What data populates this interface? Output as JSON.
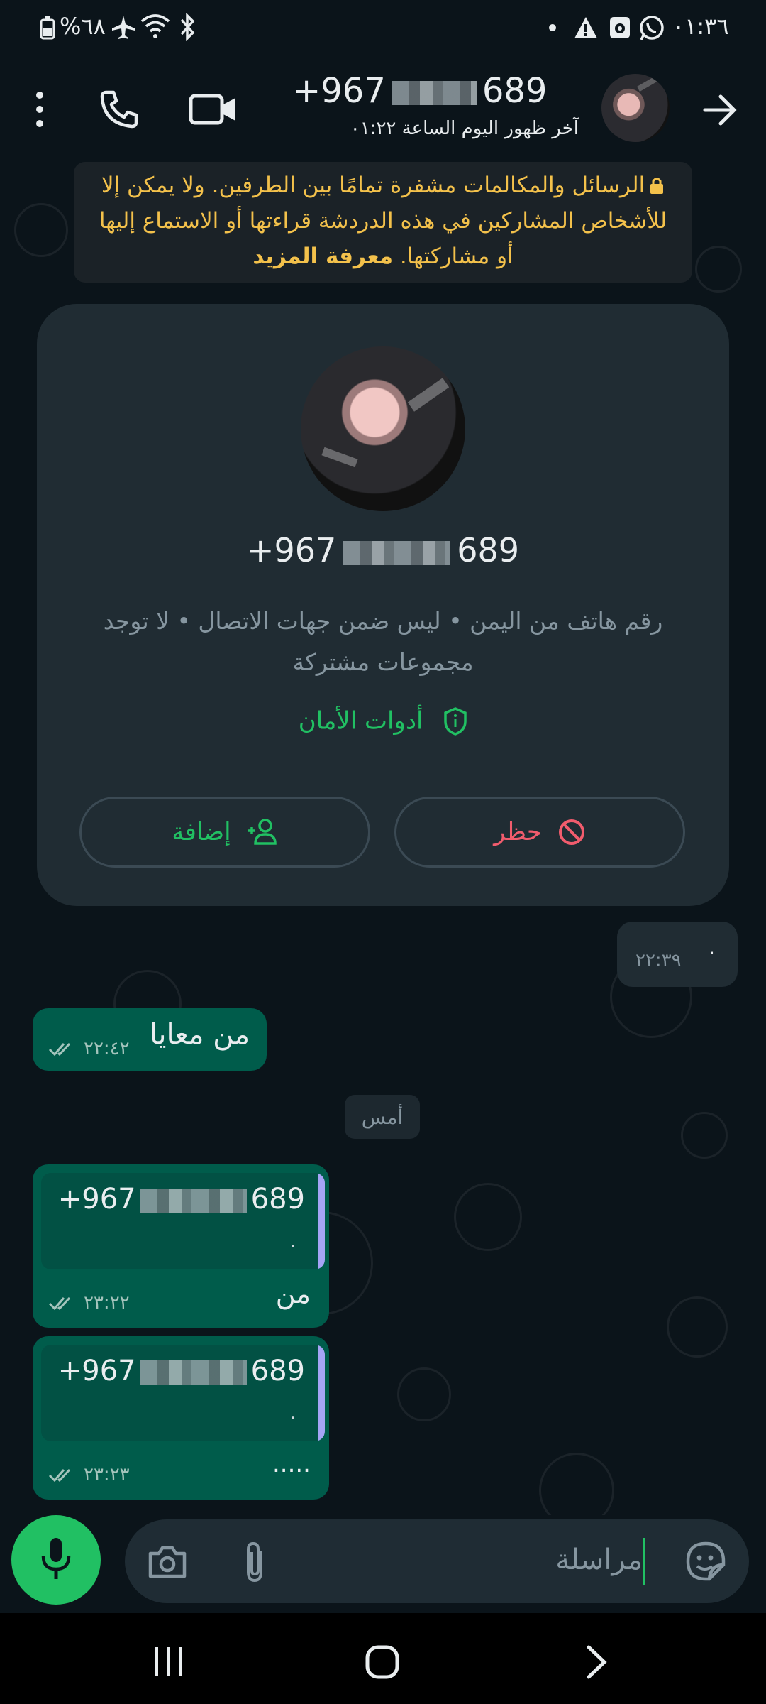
{
  "status_bar": {
    "time": "٠١:٣٦",
    "battery_text": "%٦٨",
    "icons": [
      "battery-icon",
      "airplane-icon",
      "wifi-icon",
      "bluetooth-icon",
      "dot-icon",
      "warning-icon",
      "app-icon",
      "whatsapp-icon"
    ]
  },
  "header": {
    "contact_phone_prefix": "+967",
    "contact_phone_suffix": "689",
    "last_seen": "آخر ظهور اليوم الساعة ٠١:٢٢",
    "icons": [
      "more-icon",
      "call-icon",
      "video-call-icon",
      "back-arrow-icon"
    ]
  },
  "encryption_notice": {
    "text": "الرسائل والمكالمات مشفرة تمامًا بين الطرفين. ولا يمكن إلا للأشخاص المشاركين في هذه الدردشة قراءتها أو الاستماع إليها أو مشاركتها.",
    "link": "معرفة المزيد"
  },
  "contact_card": {
    "phone_prefix": "+967",
    "phone_suffix": "689",
    "description": "رقم هاتف من اليمن • ليس ضمن جهات الاتصال • لا توجد مجموعات مشتركة",
    "security_tools": "أدوات الأمان",
    "block_label": "حظر",
    "add_label": "إضافة"
  },
  "messages": [
    {
      "dir": "in",
      "text": "٠",
      "time": "٢٢:٣٩"
    },
    {
      "dir": "out",
      "text": "من معايا",
      "time": "٢٢:٤٢"
    },
    {
      "type": "date",
      "text": "أمس"
    },
    {
      "dir": "out",
      "quote_prefix": "+967",
      "quote_suffix": "689",
      "quote_text": ".",
      "text": "من",
      "time": "٢٣:٢٢"
    },
    {
      "dir": "out",
      "quote_prefix": "+967",
      "quote_suffix": "689",
      "quote_text": ".",
      "text": ".....",
      "time": "٢٣:٢٣"
    }
  ],
  "input": {
    "placeholder": "مراسلة",
    "icons": [
      "mic-icon",
      "camera-icon",
      "attach-icon",
      "sticker-icon"
    ]
  },
  "nav_bar": {
    "icons": [
      "recents-icon",
      "home-icon",
      "back-icon"
    ]
  },
  "colors": {
    "accent": "#21c063",
    "outgoing": "#005c4b",
    "background": "#0b141a",
    "danger": "#f15c6d",
    "notice": "#f3c14b"
  }
}
